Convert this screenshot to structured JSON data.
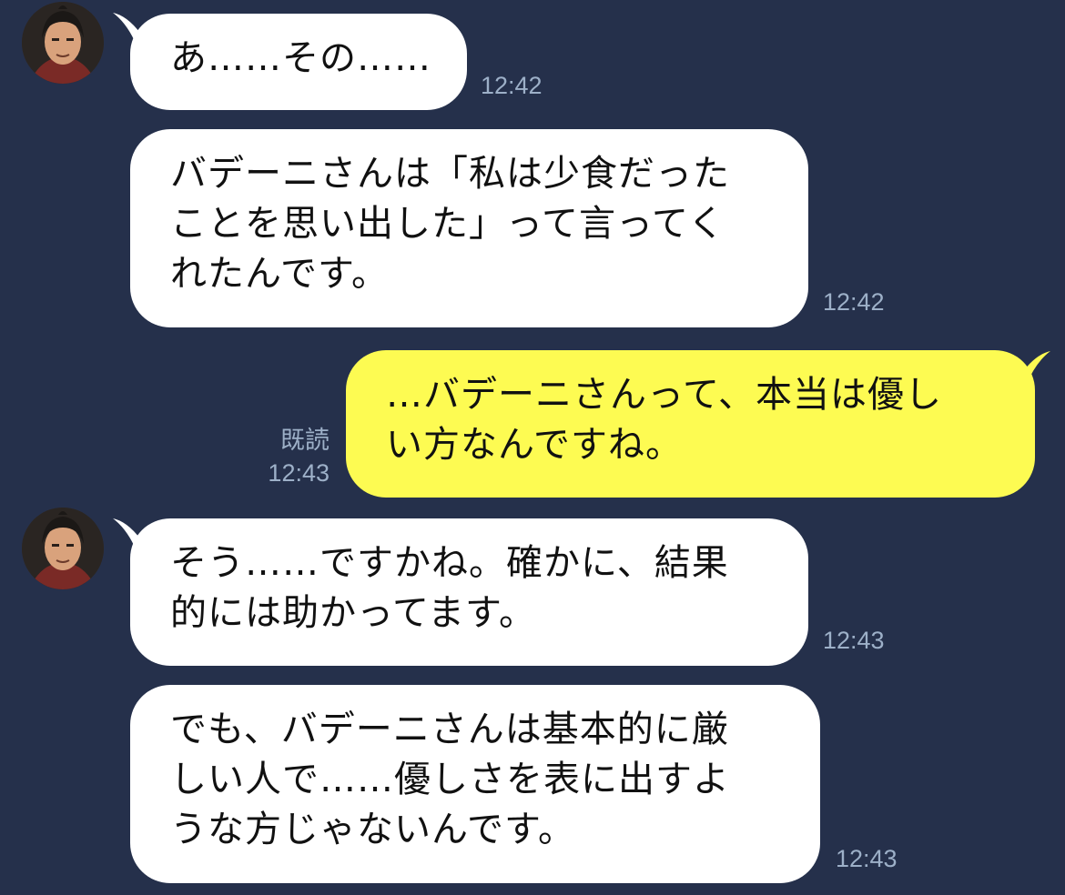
{
  "colors": {
    "background": "#25304b",
    "incoming_bubble": "#ffffff",
    "outgoing_bubble": "#fdfb52",
    "meta_text": "#9db0c8"
  },
  "contact": {
    "avatar_icon": "anime-character-avatar"
  },
  "messages": [
    {
      "direction": "in",
      "lines": [
        "あ……その……"
      ],
      "time": "12:42"
    },
    {
      "direction": "in",
      "lines": [
        "バデーニさんは「私は少食だった",
        "ことを思い出した」って言ってく",
        "れたんです。"
      ],
      "time": "12:42"
    },
    {
      "direction": "out",
      "lines": [
        "…バデーニさんって、本当は優し",
        "い方なんですね。"
      ],
      "read": "既読",
      "time": "12:43"
    },
    {
      "direction": "in",
      "lines": [
        "そう……ですかね。確かに、結果",
        "的には助かってます。"
      ],
      "time": "12:43"
    },
    {
      "direction": "in",
      "lines": [
        "でも、バデーニさんは基本的に厳",
        "しい人で……優しさを表に出すよ",
        "うな方じゃないんです。"
      ],
      "time": "12:43"
    }
  ]
}
